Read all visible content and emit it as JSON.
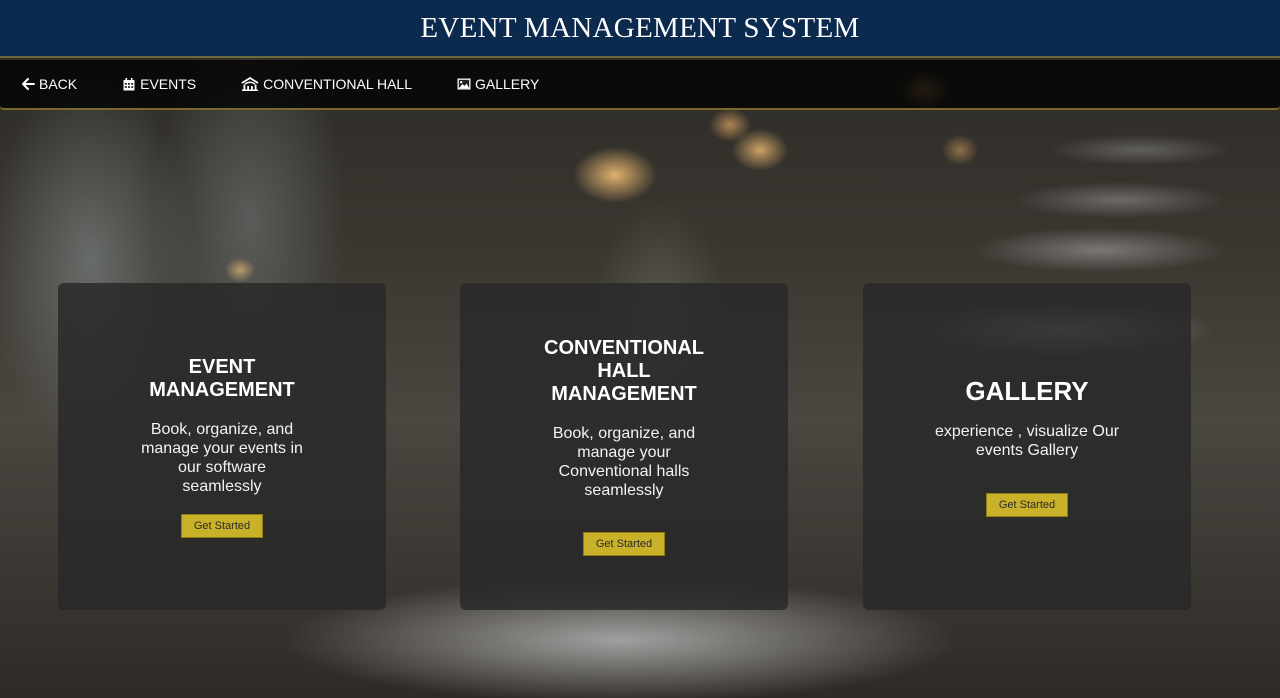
{
  "header": {
    "title": "EVENT MANAGEMENT SYSTEM",
    "color": "#0c2a4e"
  },
  "nav": {
    "items": [
      {
        "label": "BACK",
        "icon": "arrow-left-icon"
      },
      {
        "label": "EVENTS",
        "icon": "calendar-icon"
      },
      {
        "label": "CONVENTIONAL HALL",
        "icon": "hall-icon"
      },
      {
        "label": "GALLERY",
        "icon": "image-icon"
      }
    ]
  },
  "cards": [
    {
      "title": "EVENT MANAGEMENT",
      "description": "Book, organize, and manage your events in our software seamlessly",
      "button": "Get Started"
    },
    {
      "title": "CONVENTIONAL HALL MANAGEMENT",
      "description": "Book, organize, and manage your Conventional halls seamlessly",
      "button": "Get Started"
    },
    {
      "title": "GALLERY",
      "description": "experience , visualize Our events Gallery",
      "button": "Get Started"
    }
  ],
  "colors": {
    "button": "#c9b22a",
    "card": "#282828"
  }
}
